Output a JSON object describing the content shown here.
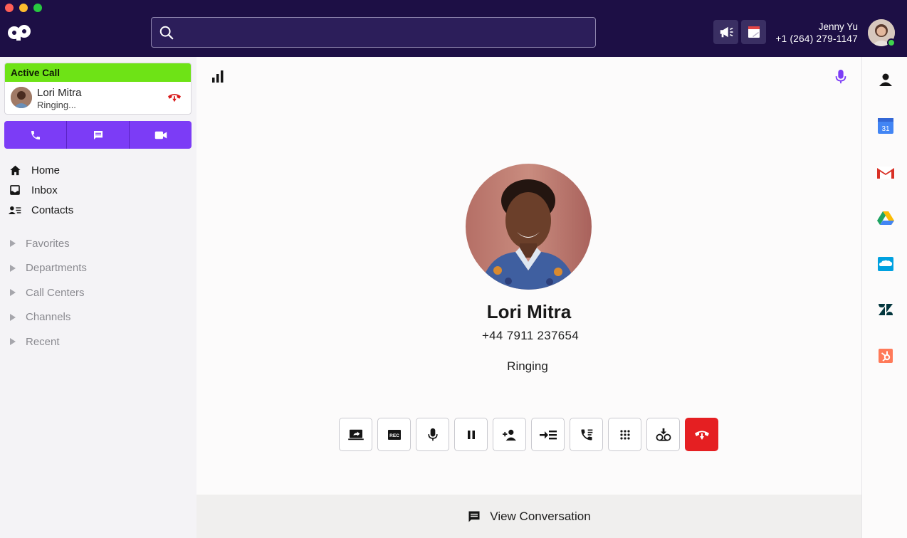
{
  "topbar": {
    "search_value": "",
    "announce_icon": "megaphone-icon",
    "calendar_icon": "notepad-icon",
    "user": {
      "name": "Jenny Yu",
      "phone": "+1 (264) 279-1147"
    }
  },
  "sidebar": {
    "active_call": {
      "header": "Active Call",
      "name": "Lori Mitra",
      "status": "Ringing..."
    },
    "actions": [
      "phone-icon",
      "message-icon",
      "video-icon"
    ],
    "nav": [
      {
        "label": "Home",
        "icon": "home-icon"
      },
      {
        "label": "Inbox",
        "icon": "inbox-icon"
      },
      {
        "label": "Contacts",
        "icon": "contacts-icon"
      }
    ],
    "groups": [
      "Favorites",
      "Departments",
      "Call Centers",
      "Channels",
      "Recent"
    ]
  },
  "call": {
    "name": "Lori Mitra",
    "phone": "+44 7911 237654",
    "status": "Ringing",
    "controls": [
      "screen-share-icon",
      "record-icon",
      "mute-icon",
      "hold-icon",
      "add-person-icon",
      "transfer-icon",
      "call-queue-icon",
      "keypad-icon",
      "voicemail-icon",
      "hang-up-icon"
    ],
    "record_label": "REC"
  },
  "conversation": {
    "label": "View Conversation"
  },
  "rail": {
    "icons": [
      "person-icon",
      "google-calendar-icon",
      "gmail-icon",
      "google-drive-icon",
      "salesforce-icon",
      "zendesk-icon",
      "hubspot-icon"
    ],
    "calendar_day": "31"
  },
  "colors": {
    "topbar": "#1d0f45",
    "accent_purple": "#7c3cf6",
    "active_green": "#6ee316",
    "hangup_red": "#e51f22"
  }
}
